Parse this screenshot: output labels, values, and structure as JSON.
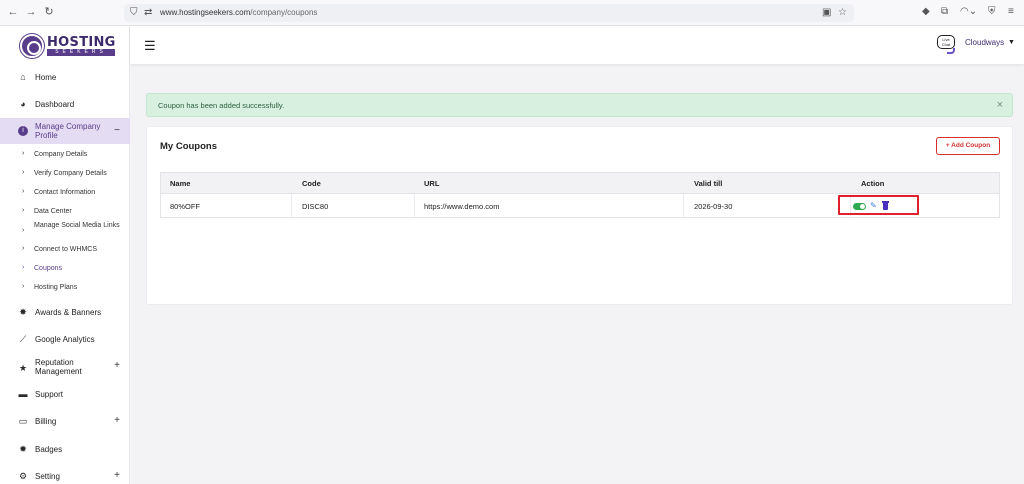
{
  "browser": {
    "url_host": "www.hostingseekers.com",
    "url_path": "/company/coupons"
  },
  "brand": {
    "logo_text": "HOSTING",
    "logo_subtext": "SEEKERS",
    "accent_color": "#5a3d8a"
  },
  "sidebar": {
    "items": [
      {
        "label": "Home",
        "icon": "home-icon"
      },
      {
        "label": "Dashboard",
        "icon": "dashboard-icon"
      },
      {
        "label": "Manage Company Profile",
        "icon": "info-icon",
        "toggle": "−"
      },
      {
        "label": "Awards & Banners",
        "icon": "award-icon"
      },
      {
        "label": "Google Analytics",
        "icon": "chart-icon"
      },
      {
        "label": "Reputation Management",
        "icon": "star-icon",
        "toggle": "+"
      },
      {
        "label": "Support",
        "icon": "support-icon"
      },
      {
        "label": "Billing",
        "icon": "billing-icon",
        "toggle": "+"
      },
      {
        "label": "Badges",
        "icon": "badge-icon"
      },
      {
        "label": "Setting",
        "icon": "settings-icon",
        "toggle": "+"
      }
    ],
    "sub_items": [
      {
        "label": "Company Details"
      },
      {
        "label": "Verify Company Details"
      },
      {
        "label": "Contact Information"
      },
      {
        "label": "Data Center"
      },
      {
        "label": "Manage Social Media Links"
      },
      {
        "label": "Connect to WHMCS"
      },
      {
        "label": "Coupons"
      },
      {
        "label": "Hosting Plans"
      }
    ]
  },
  "header": {
    "livechat_label": "Live Chat",
    "user_name": "Cloudways"
  },
  "alert": {
    "message": "Coupon has been added successfully.",
    "close": "×"
  },
  "coupons": {
    "title": "My Coupons",
    "add_button": "+ Add Coupon",
    "columns": [
      "Name",
      "Code",
      "URL",
      "Valid till",
      "Action"
    ],
    "rows": [
      {
        "name": "80%OFF",
        "code": "DISC80",
        "url": "https://www.demo.com",
        "valid_till": "2026-09-30",
        "active": true
      }
    ]
  }
}
